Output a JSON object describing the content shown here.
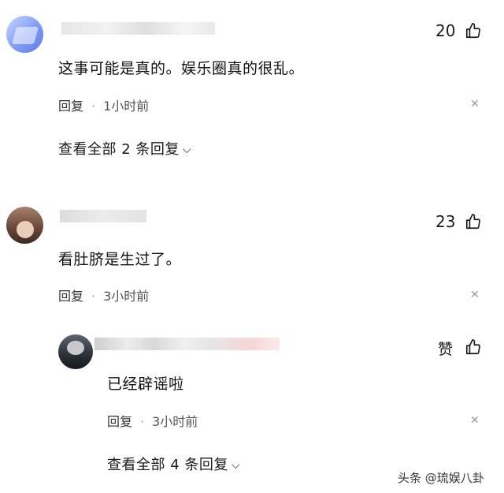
{
  "comments": [
    {
      "like_count": "20",
      "text": "这事可能是真的。娱乐圈真的很乱。",
      "reply_label": "回复",
      "time": "1小时前",
      "view_replies": "查看全部 2 条回复"
    },
    {
      "like_count": "23",
      "text": "看肚脐是生过了。",
      "reply_label": "回复",
      "time": "3小时前",
      "reply": {
        "like_label": "赞",
        "text": "已经辟谣啦",
        "reply_label": "回复",
        "time": "3小时前"
      },
      "view_replies": "查看全部 4 条回复"
    }
  ],
  "icons": {
    "like": "thumbs-up-icon",
    "close": "close-icon",
    "expand": "chevron-down-icon"
  },
  "watermark": "头条 @琉娱八卦"
}
